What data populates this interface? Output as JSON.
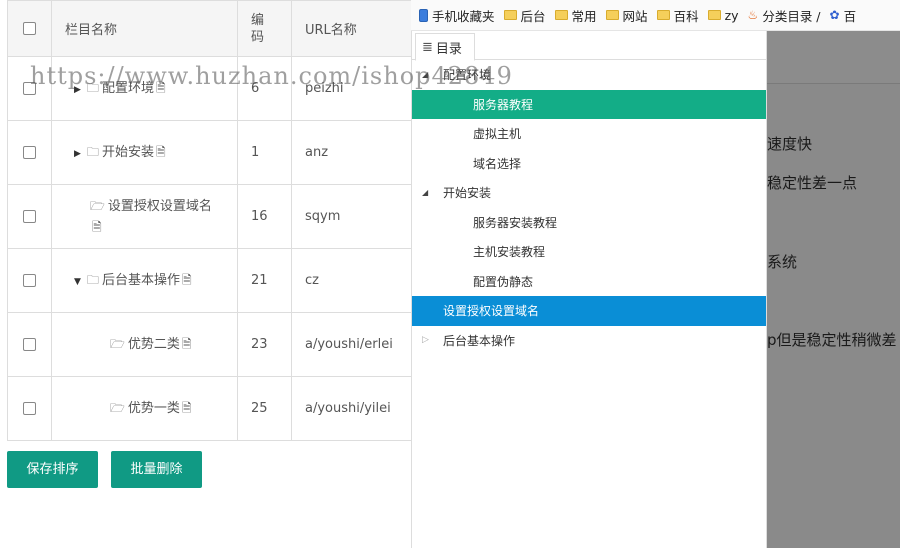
{
  "table": {
    "headers": {
      "name": "栏目名称",
      "code": "编\n码",
      "code_top": "编",
      "code_bottom": "码",
      "url": "URL名称"
    },
    "rows": [
      {
        "name": "配置环境",
        "code": "6",
        "url": "peizhi"
      },
      {
        "name": "开始安装",
        "code": "1",
        "url": "anz"
      },
      {
        "name": "设置授权设置域名",
        "code": "16",
        "url": "sqym"
      },
      {
        "name": "后台基本操作",
        "code": "21",
        "url": "cz"
      },
      {
        "name": "优势二类",
        "code": "23",
        "url": "a/youshi/erlei"
      },
      {
        "name": "优势一类",
        "code": "25",
        "url": "a/youshi/yilei"
      }
    ]
  },
  "buttons": {
    "save": "保存排序",
    "delete": "批量删除"
  },
  "watermark": "https://www.huzhan.com/ishop42849",
  "bookmarks": [
    {
      "label": "手机收藏夹",
      "icon": "mobile-icon"
    },
    {
      "label": "后台",
      "icon": "folder-icon"
    },
    {
      "label": "常用",
      "icon": "folder-icon"
    },
    {
      "label": "网站",
      "icon": "folder-icon"
    },
    {
      "label": "百科",
      "icon": "folder-icon"
    },
    {
      "label": "zy",
      "icon": "folder-icon"
    },
    {
      "label": "分类目录 /",
      "icon": "flame-icon"
    },
    {
      "label": "百",
      "icon": "paw-icon"
    }
  ],
  "directory": {
    "tab_label": "目录",
    "nodes": [
      {
        "label": "配置环境",
        "level": 1,
        "state": "expanded"
      },
      {
        "label": "服务器教程",
        "level": 2,
        "state": "selected-green"
      },
      {
        "label": "虚拟主机",
        "level": 2
      },
      {
        "label": "域名选择",
        "level": 2
      },
      {
        "label": "开始安装",
        "level": 1,
        "state": "expanded"
      },
      {
        "label": "服务器安装教程",
        "level": 2
      },
      {
        "label": "主机安装教程",
        "level": 2
      },
      {
        "label": "配置伪静态",
        "level": 2
      },
      {
        "label": "设置授权设置域名",
        "level": 1,
        "state": "selected-blue"
      },
      {
        "label": "后台基本操作",
        "level": 1,
        "state": "collapsed"
      }
    ]
  },
  "right_fragments": [
    "速度快",
    "稳定性差一点",
    "系统",
    "p但是稳定性稍微差"
  ],
  "colors": {
    "primary_button": "#109a84",
    "tree_selected_green": "#13ad87",
    "tree_selected_blue": "#0a8ed6",
    "overlay_gray": "#8a8a8a"
  }
}
